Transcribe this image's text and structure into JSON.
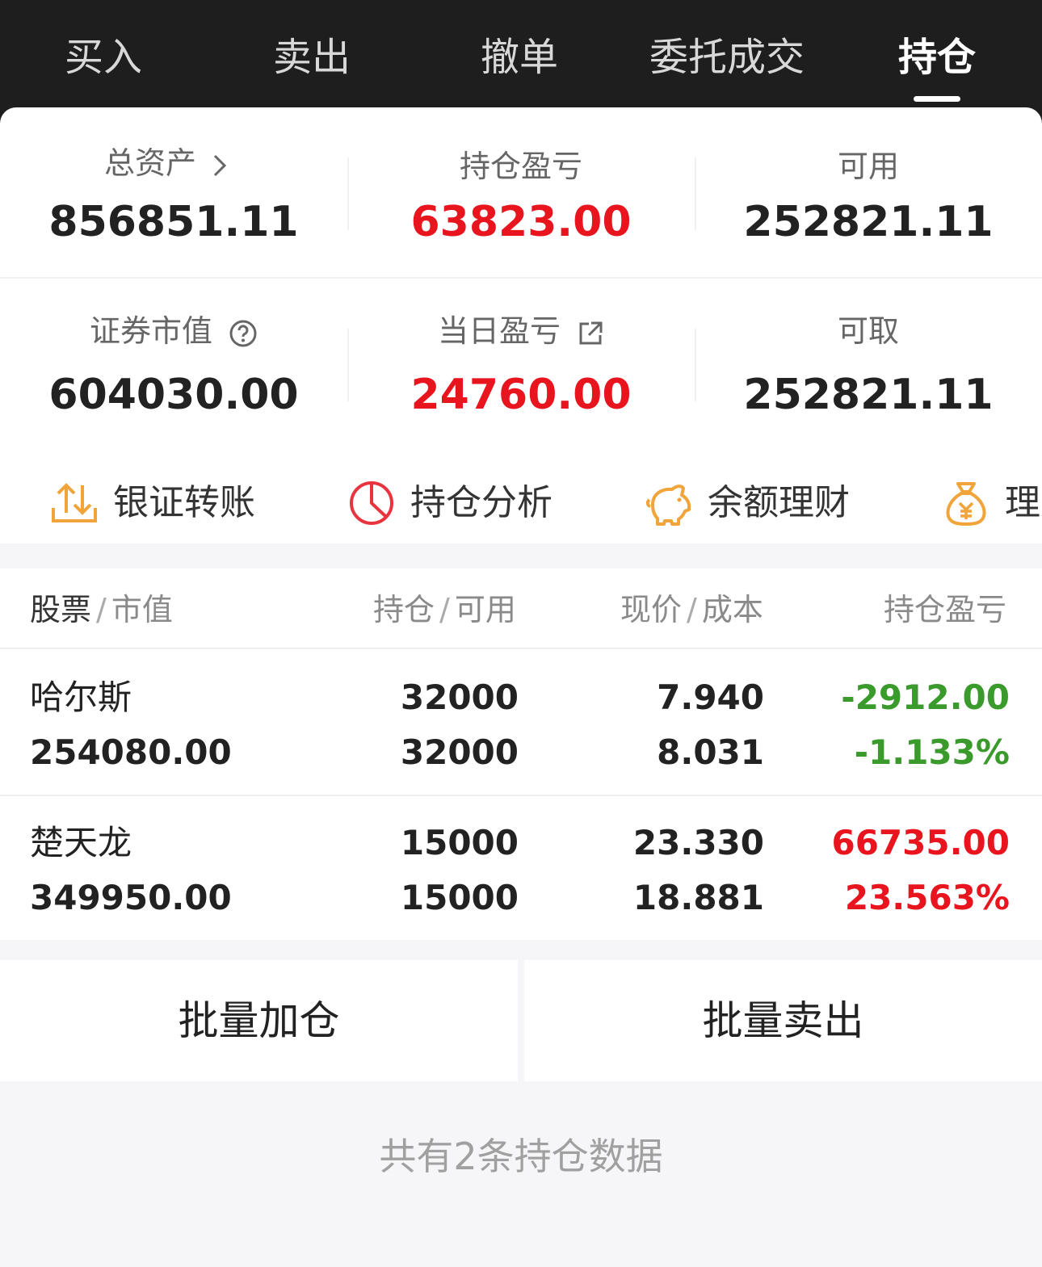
{
  "tabs": [
    {
      "label": "买入",
      "active": false
    },
    {
      "label": "卖出",
      "active": false
    },
    {
      "label": "撤单",
      "active": false
    },
    {
      "label": "委托成交",
      "active": false
    },
    {
      "label": "持仓",
      "active": true
    }
  ],
  "summary": {
    "total_assets": {
      "label": "总资产",
      "value": "856851.11"
    },
    "position_pnl": {
      "label": "持仓盈亏",
      "value": "63823.00"
    },
    "available": {
      "label": "可用",
      "value": "252821.11"
    },
    "market_value": {
      "label": "证券市值",
      "value": "604030.00"
    },
    "daily_pnl": {
      "label": "当日盈亏",
      "value": "24760.00"
    },
    "withdrawable": {
      "label": "可取",
      "value": "252821.11"
    }
  },
  "actions": [
    {
      "label": "银证转账",
      "icon": "transfer-icon"
    },
    {
      "label": "持仓分析",
      "icon": "pie-chart-icon"
    },
    {
      "label": "余额理财",
      "icon": "piggy-bank-icon"
    },
    {
      "label": "理财",
      "icon": "money-bag-icon"
    }
  ],
  "table": {
    "headers": {
      "stock": "股票",
      "market_value": "市值",
      "holding": "持仓",
      "available": "可用",
      "price": "现价",
      "cost": "成本",
      "pnl": "持仓盈亏"
    },
    "rows": [
      {
        "name": "哈尔斯",
        "market_value": "254080.00",
        "holding": "32000",
        "available": "32000",
        "price": "7.940",
        "cost": "8.031",
        "pnl": "-2912.00",
        "pnl_pct": "-1.133%"
      },
      {
        "name": "楚天龙",
        "market_value": "349950.00",
        "holding": "15000",
        "available": "15000",
        "price": "23.330",
        "cost": "18.881",
        "pnl": "66735.00",
        "pnl_pct": "23.563%"
      }
    ]
  },
  "buttons": {
    "batch_add": "批量加仓",
    "batch_sell": "批量卖出"
  },
  "footer": "共有2条持仓数据",
  "colors": {
    "loss": "#3a9a2c",
    "gain": "#e8141e",
    "icon_orange": "#f0a43a",
    "icon_red": "#e8343e"
  }
}
